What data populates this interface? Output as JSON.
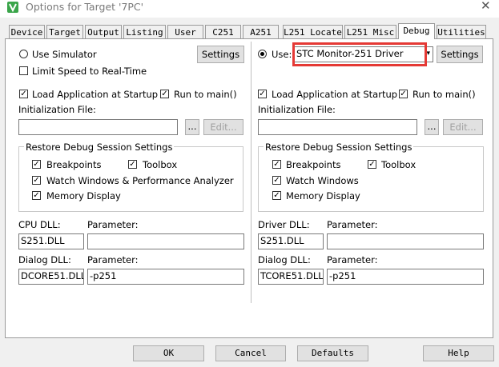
{
  "window": {
    "title": "Options for Target '7PC'"
  },
  "tabs": [
    "Device",
    "Target",
    "Output",
    "Listing",
    "User",
    "C251",
    "A251",
    "L251 Locate",
    "L251 Misc",
    "Debug",
    "Utilities"
  ],
  "left": {
    "use_simulator": "Use Simulator",
    "settings": "Settings",
    "limit_speed": "Limit Speed to Real-Time",
    "load_app": "Load Application at Startup",
    "run_to_main": "Run to main()",
    "init_file": "Initialization File:",
    "browse": "...",
    "edit": "Edit...",
    "restore_group": "Restore Debug Session Settings",
    "breakpoints": "Breakpoints",
    "toolbox": "Toolbox",
    "watch": "Watch Windows & Performance Analyzer",
    "memory": "Memory Display",
    "cpu_dll_label": "CPU DLL:",
    "cpu_param_label": "Parameter:",
    "cpu_dll": "S251.DLL",
    "cpu_param": "",
    "dialog_dll_label": "Dialog DLL:",
    "dialog_param_label": "Parameter:",
    "dialog_dll": "DCORE51.DLL",
    "dialog_param": "-p251"
  },
  "right": {
    "use": "Use:",
    "driver": "STC Monitor-251 Driver",
    "settings": "Settings",
    "load_app": "Load Application at Startup",
    "run_to_main": "Run to main()",
    "init_file": "Initialization File:",
    "browse": "...",
    "edit": "Edit...",
    "restore_group": "Restore Debug Session Settings",
    "breakpoints": "Breakpoints",
    "toolbox": "Toolbox",
    "watch": "Watch Windows",
    "memory": "Memory Display",
    "driver_dll_label": "Driver DLL:",
    "driver_param_label": "Parameter:",
    "driver_dll": "S251.DLL",
    "driver_param": "",
    "dialog_dll_label": "Dialog DLL:",
    "dialog_param_label": "Parameter:",
    "dialog_dll": "TCORE51.DLL",
    "dialog_param": "-p251"
  },
  "buttons": {
    "ok": "OK",
    "cancel": "Cancel",
    "defaults": "Defaults",
    "help": "Help"
  },
  "colors": {
    "highlight": "#e53935",
    "icon": "#3aa54a"
  }
}
